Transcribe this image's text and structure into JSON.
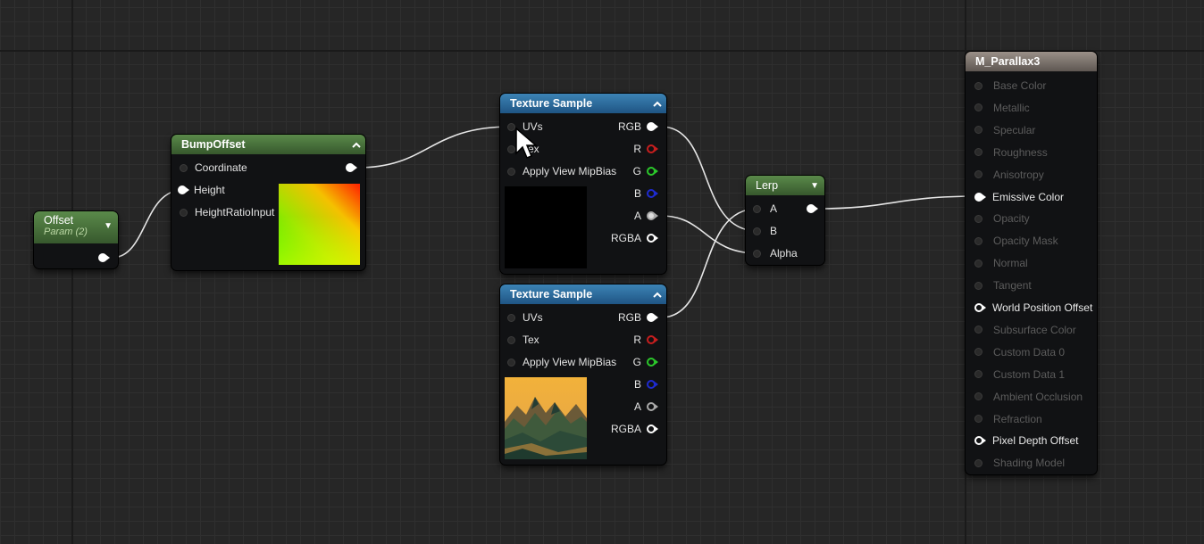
{
  "offset_node": {
    "title": "Offset",
    "subtitle": "Param (2)"
  },
  "bump_node": {
    "title": "BumpOffset",
    "inputs": [
      "Coordinate",
      "Height",
      "HeightRatioInput"
    ]
  },
  "tex1": {
    "title": "Texture Sample",
    "inputs": [
      "UVs",
      "Tex",
      "Apply View MipBias"
    ],
    "outputs": [
      "RGB",
      "R",
      "G",
      "B",
      "A",
      "RGBA"
    ]
  },
  "tex2": {
    "title": "Texture Sample",
    "inputs": [
      "UVs",
      "Tex",
      "Apply View MipBias"
    ],
    "outputs": [
      "RGB",
      "R",
      "G",
      "B",
      "A",
      "RGBA"
    ]
  },
  "lerp": {
    "title": "Lerp",
    "inputs": [
      "A",
      "B",
      "Alpha"
    ]
  },
  "material": {
    "title": "M_Parallax3",
    "pins": [
      {
        "label": "Base Color",
        "enabled": false
      },
      {
        "label": "Metallic",
        "enabled": false
      },
      {
        "label": "Specular",
        "enabled": false
      },
      {
        "label": "Roughness",
        "enabled": false
      },
      {
        "label": "Anisotropy",
        "enabled": false
      },
      {
        "label": "Emissive Color",
        "enabled": true
      },
      {
        "label": "Opacity",
        "enabled": false
      },
      {
        "label": "Opacity Mask",
        "enabled": false
      },
      {
        "label": "Normal",
        "enabled": false
      },
      {
        "label": "Tangent",
        "enabled": false
      },
      {
        "label": "World Position Offset",
        "enabled": true
      },
      {
        "label": "Subsurface Color",
        "enabled": false
      },
      {
        "label": "Custom Data 0",
        "enabled": false
      },
      {
        "label": "Custom Data 1",
        "enabled": false
      },
      {
        "label": "Ambient Occlusion",
        "enabled": false
      },
      {
        "label": "Refraction",
        "enabled": false
      },
      {
        "label": "Pixel Depth Offset",
        "enabled": true
      },
      {
        "label": "Shading Model",
        "enabled": false
      }
    ]
  },
  "colors": {
    "r_pin": "#c81e1e",
    "g_pin": "#2bc82b",
    "b_pin": "#1e2bd0",
    "header_blue": "#2f6ea0",
    "header_green": "#4a7a3c"
  }
}
